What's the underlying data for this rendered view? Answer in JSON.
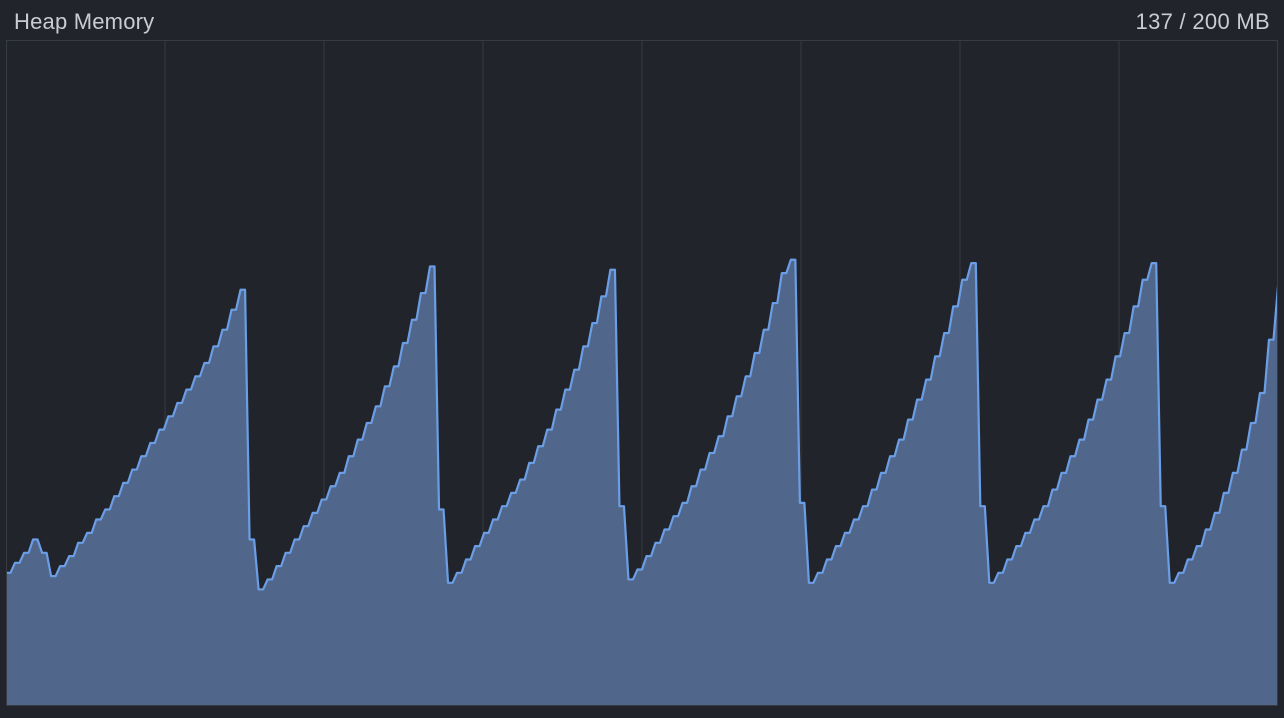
{
  "header": {
    "title": "Heap Memory",
    "value_text": "137 / 200 MB"
  },
  "colors": {
    "background": "#21252b",
    "grid": "#373b42",
    "fill": "#53698f",
    "stroke": "#6b9ee6",
    "text": "#c9ccd1"
  },
  "chart_data": {
    "type": "area",
    "title": "Heap Memory",
    "xlabel": "",
    "ylabel": "MB",
    "ylim": [
      0,
      200
    ],
    "grid_x_count": 8,
    "x": [
      0,
      1,
      2,
      3,
      4,
      5,
      6,
      7,
      8,
      9,
      10,
      11,
      12,
      13,
      14,
      15,
      16,
      17,
      18,
      19,
      20,
      21,
      22,
      23,
      24,
      25,
      26,
      27,
      28,
      29,
      30,
      31,
      32,
      33,
      34,
      35,
      36,
      37,
      38,
      39,
      40,
      41,
      42,
      43,
      44,
      45,
      46,
      47,
      48,
      49,
      50,
      51,
      52,
      53,
      54,
      55,
      56,
      57,
      58,
      59,
      60,
      61,
      62,
      63,
      64,
      65,
      66,
      67,
      68,
      69,
      70,
      71,
      72,
      73,
      74,
      75,
      76,
      77,
      78,
      79,
      80,
      81,
      82,
      83,
      84,
      85,
      86,
      87,
      88,
      89,
      90,
      91,
      92,
      93,
      94,
      95,
      96,
      97,
      98,
      99,
      100,
      101,
      102,
      103,
      104,
      105,
      106,
      107,
      108,
      109,
      110,
      111,
      112,
      113,
      114,
      115,
      116,
      117,
      118,
      119,
      120,
      121,
      122,
      123,
      124,
      125,
      126,
      127,
      128,
      129,
      130,
      131,
      132,
      133,
      134,
      135,
      136,
      137,
      138,
      139,
      140,
      141
    ],
    "values": [
      40,
      43,
      46,
      50,
      46,
      39,
      42,
      45,
      49,
      52,
      56,
      59,
      63,
      67,
      71,
      75,
      79,
      83,
      87,
      91,
      95,
      99,
      103,
      108,
      113,
      119,
      125,
      50,
      35,
      38,
      42,
      46,
      50,
      54,
      58,
      62,
      66,
      70,
      75,
      80,
      85,
      90,
      96,
      102,
      109,
      116,
      124,
      132,
      59,
      37,
      40,
      44,
      48,
      52,
      56,
      60,
      64,
      68,
      73,
      78,
      83,
      89,
      95,
      101,
      108,
      115,
      123,
      131,
      60,
      38,
      41,
      45,
      49,
      53,
      57,
      61,
      66,
      71,
      76,
      81,
      87,
      93,
      99,
      106,
      113,
      121,
      130,
      134,
      61,
      37,
      40,
      44,
      48,
      52,
      56,
      60,
      65,
      70,
      75,
      80,
      86,
      92,
      98,
      105,
      112,
      120,
      128,
      133,
      60,
      37,
      40,
      44,
      48,
      52,
      56,
      60,
      65,
      70,
      75,
      80,
      86,
      92,
      98,
      105,
      112,
      120,
      128,
      133,
      60,
      37,
      40,
      44,
      48,
      53,
      58,
      64,
      70,
      77,
      85,
      94,
      110,
      126
    ]
  }
}
